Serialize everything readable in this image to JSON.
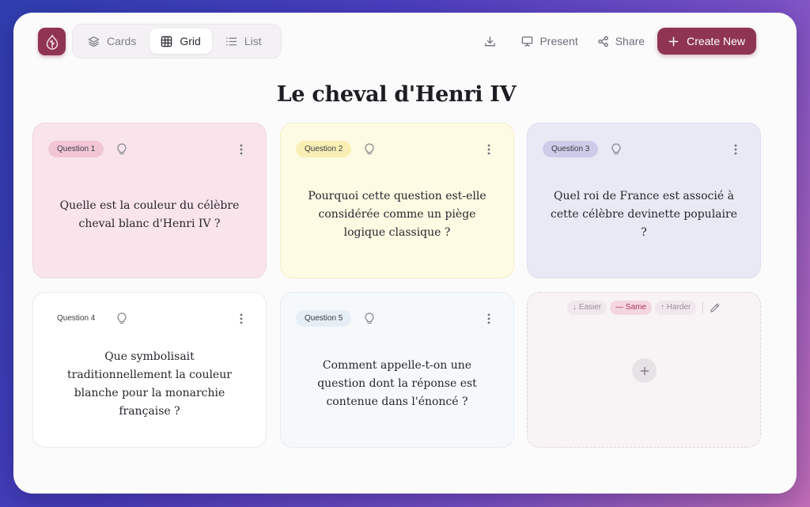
{
  "toolbar": {
    "views": [
      "Cards",
      "Grid",
      "List"
    ],
    "active_view": "Grid",
    "present_label": "Present",
    "share_label": "Share",
    "create_label": "Create New"
  },
  "page": {
    "title": "Le cheval d'Henri IV"
  },
  "cards": [
    {
      "badge": "Question 1",
      "text": "Quelle est la couleur du célèbre cheval blanc d'Henri IV ?"
    },
    {
      "badge": "Question 2",
      "text": "Pourquoi cette question est-elle considérée comme un piège logique classique ?"
    },
    {
      "badge": "Question 3",
      "text": "Quel roi de France est associé à cette célèbre devinette populaire ?"
    },
    {
      "badge": "Question 4",
      "text": "Que symbolisait traditionnellement la couleur blanche pour la monarchie française ?"
    },
    {
      "badge": "Question 5",
      "text": "Comment appelle-t-on une question dont la réponse est contenue dans l'énoncé ?"
    }
  ],
  "difficulty": {
    "easier": "↓ Easier",
    "same": "— Same",
    "harder": "↑ Harder",
    "active": "Same"
  },
  "colors": {
    "accent": "#8f3553",
    "card1": "#f9e4eb",
    "card2": "#fdfbe3",
    "card3": "#e9e9f5",
    "card4": "#ffffff",
    "card5": "#f6f9fc"
  }
}
